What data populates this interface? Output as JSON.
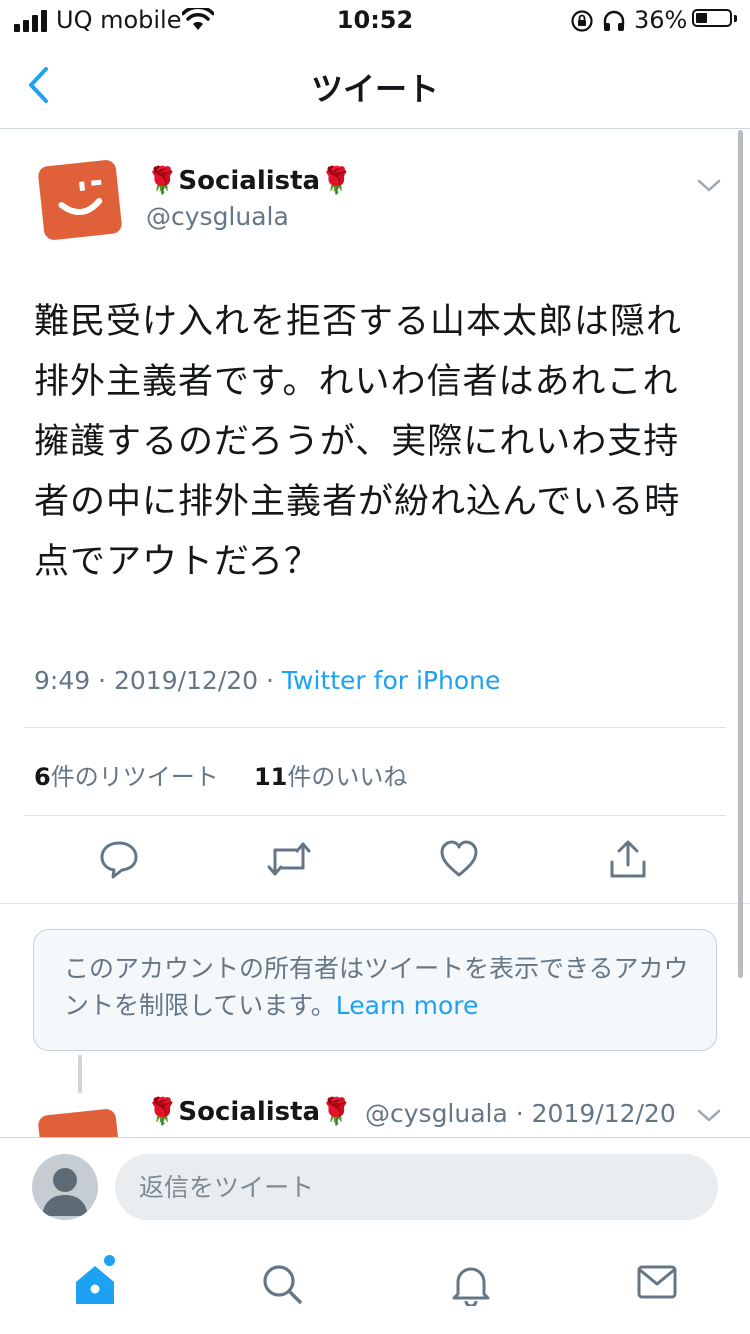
{
  "status_bar": {
    "carrier": "UQ mobile",
    "time": "10:52",
    "battery_percent": "36%",
    "battery_level": 0.36
  },
  "nav": {
    "title": "ツイート",
    "back_icon": "chevron-left-icon"
  },
  "tweet": {
    "display_name": "🌹Socialista🌹",
    "handle": "@cysgluala",
    "text": "難民受け入れを拒否する山本太郎は隠れ排外主義者です。れいわ信者はあれこれ擁護するのだろうが、実際にれいわ支持者の中に排外主義者が紛れ込んでいる時点でアウトだろ？",
    "time": "9:49",
    "date": "2019/12/20",
    "source": "Twitter for iPhone",
    "retweet_count": "6",
    "retweet_label": "件のリツイート",
    "like_count": "11",
    "like_label": "件のいいね",
    "actions": [
      "reply-icon",
      "retweet-icon",
      "like-icon",
      "share-icon"
    ]
  },
  "notice": {
    "text": "このアカウントの所有者はツイートを表示できるアカウントを制限しています。",
    "link": "Learn more"
  },
  "reply_tweet": {
    "display_name": "🌹Socialista🌹",
    "handle_date": "@cysgluala · 2019/12/20"
  },
  "reply_box": {
    "placeholder": "返信をツイート"
  },
  "tab_bar": {
    "items": [
      "home-icon",
      "search-icon",
      "notifications-icon",
      "messages-icon"
    ]
  },
  "colors": {
    "accent": "#1da1f2",
    "secondary_text": "#657786",
    "avatar": "#e0603a"
  }
}
